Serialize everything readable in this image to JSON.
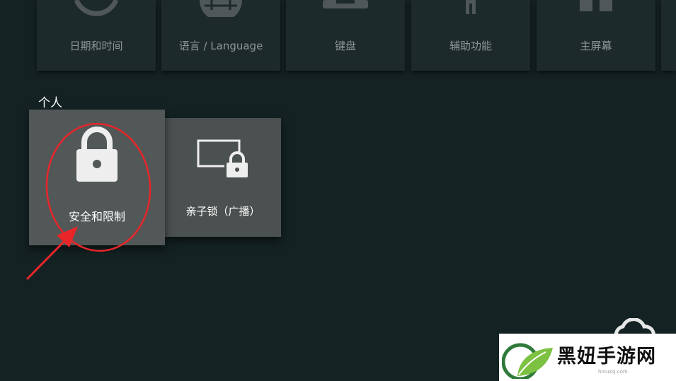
{
  "top_row": [
    {
      "label": "日期和时间",
      "icon": "clock-icon"
    },
    {
      "label": "语言 / Language",
      "icon": "globe-icon"
    },
    {
      "label": "键盘",
      "icon": "keyboard-icon"
    },
    {
      "label": "辅助功能",
      "icon": "accessibility-icon"
    },
    {
      "label": "主屏幕",
      "icon": "home-screen-icon"
    }
  ],
  "section": {
    "title": "个人"
  },
  "cards": {
    "security": {
      "label": "安全和限制",
      "icon": "lock-icon"
    },
    "parental": {
      "label": "亲子锁（广播）",
      "icon": "screen-lock-icon"
    }
  },
  "watermark": {
    "text": "黑妞手游网",
    "url": "hniuzsj.com"
  },
  "colors": {
    "background": "#142224",
    "tile": "#1d2a2c",
    "card": "#4b5050",
    "annotation": "#e8262a"
  }
}
